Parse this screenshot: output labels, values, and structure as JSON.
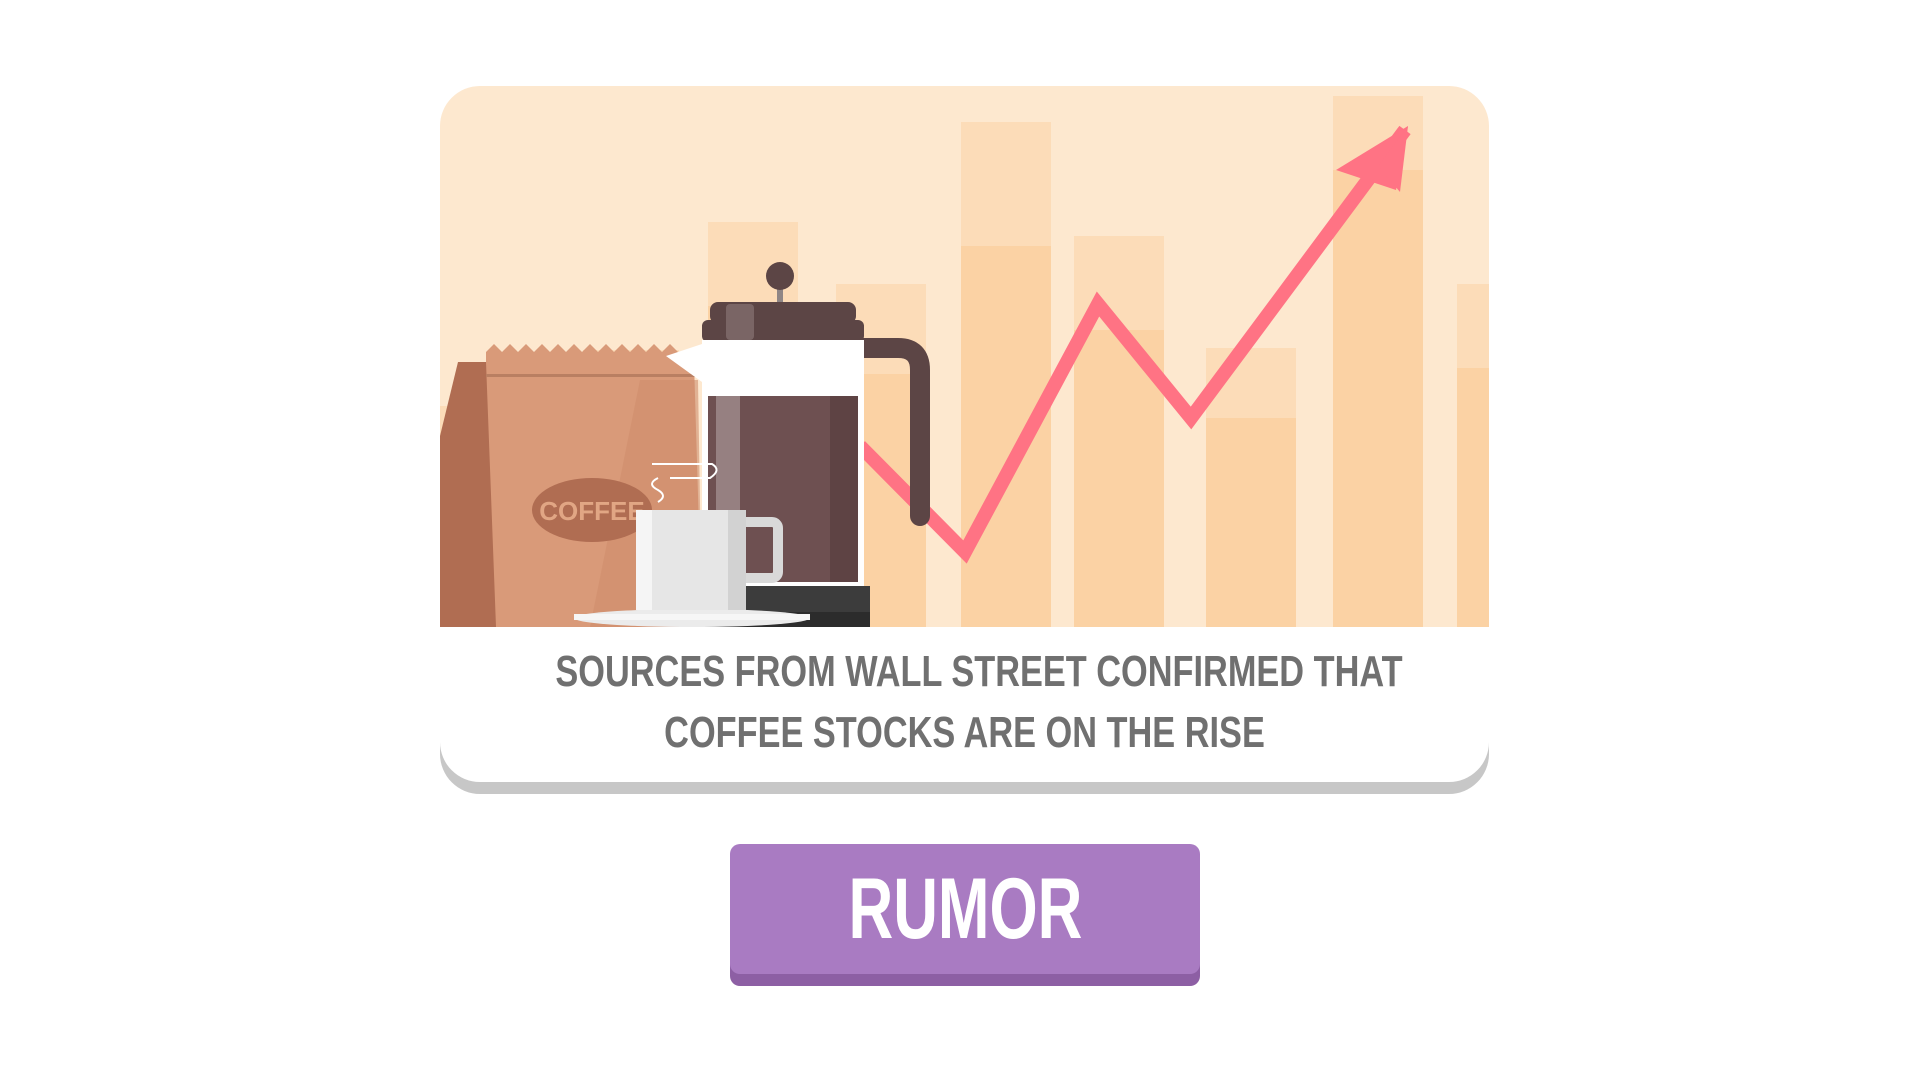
{
  "card": {
    "caption_line1": "SOURCES FROM WALL STREET CONFIRMED THAT",
    "caption_line2": "COFFEE STOCKS ARE ON THE RISE",
    "illustration": {
      "bag_label": "COFFEE",
      "icons": [
        "coffee-bag-icon",
        "french-press-icon",
        "coffee-cup-icon",
        "rising-trend-arrow-icon"
      ]
    }
  },
  "button": {
    "label": "RUMOR"
  },
  "colors": {
    "illustration_background": "#fde8cf",
    "bar_light": "#fcdcb8",
    "bar_mid": "#fbd2a4",
    "arrow": "#ff7384",
    "bag": "#d99a79",
    "bag_dark": "#b06d52",
    "press": "#5c4545",
    "caption_text": "#707070",
    "button": "#a97bc2",
    "button_shadow": "#8d5fa4",
    "button_text": "#ffffff",
    "card_shadow": "#c7c7c7"
  }
}
